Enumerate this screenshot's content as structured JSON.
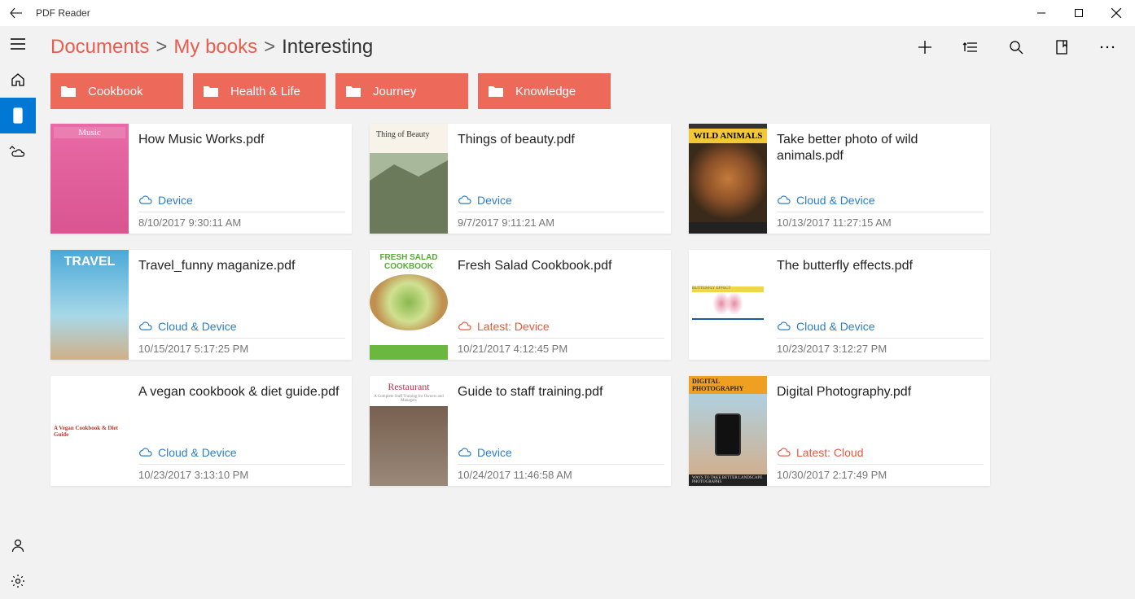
{
  "app_title": "PDF Reader",
  "breadcrumb": {
    "p0": "Documents",
    "p1": "My books",
    "p2": "Interesting"
  },
  "folders": [
    {
      "label": "Cookbook"
    },
    {
      "label": "Health & Life"
    },
    {
      "label": "Journey"
    },
    {
      "label": "Knowledge"
    }
  ],
  "files": [
    {
      "title": "How Music Works.pdf",
      "loc": "Device",
      "latest": false,
      "date": "8/10/2017 9:30:11 AM"
    },
    {
      "title": "Things of beauty.pdf",
      "loc": "Device",
      "latest": false,
      "date": "9/7/2017 9:11:21 AM"
    },
    {
      "title": "Take better photo of wild animals.pdf",
      "loc": "Cloud & Device",
      "latest": false,
      "date": "10/13/2017 11:27:15 AM"
    },
    {
      "title": "Travel_funny maganize.pdf",
      "loc": "Cloud & Device",
      "latest": false,
      "date": "10/15/2017 5:17:25 PM"
    },
    {
      "title": "Fresh Salad Cookbook.pdf",
      "loc": "Latest: Device",
      "latest": true,
      "date": "10/21/2017 4:12:45 PM"
    },
    {
      "title": "The butterfly effects.pdf",
      "loc": "Cloud & Device",
      "latest": false,
      "date": "10/23/2017 3:12:27 PM"
    },
    {
      "title": "A vegan cookbook & diet guide.pdf",
      "loc": "Cloud & Device",
      "latest": false,
      "date": "10/23/2017 3:13:10 PM"
    },
    {
      "title": "Guide to staff training.pdf",
      "loc": "Device",
      "latest": false,
      "date": "10/24/2017 11:46:58 AM"
    },
    {
      "title": "Digital Photography.pdf",
      "loc": "Latest: Cloud",
      "latest": true,
      "date": "10/30/2017 2:17:49 PM"
    }
  ],
  "thumbs": {
    "wild_top": "WILD ANIMALS",
    "travel": "TRAVEL",
    "salad": "FRESH SALAD COOKBOOK",
    "rest": "Restaurant",
    "photo_band": "DIGITAL PHOTOGRAPHY",
    "photo_bar": "WAYS TO TAKE BETTER LANDSCAPE PHOTOGRAPHS",
    "vegan": "A Vegan Cookbook & Diet Guide",
    "music": "Music"
  }
}
